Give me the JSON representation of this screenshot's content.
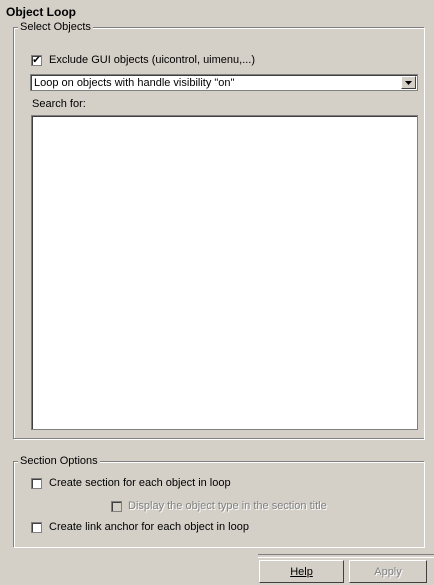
{
  "panel": {
    "title": "Object Loop"
  },
  "select_objects": {
    "legend": "Select Objects",
    "exclude_gui": {
      "label": "Exclude GUI objects (uicontrol, uimenu,...)",
      "checked": true
    },
    "loop_dropdown": {
      "selected": "Loop on objects with handle visibility \"on\""
    },
    "search_label": "Search for:"
  },
  "section_options": {
    "legend": "Section Options",
    "create_section": {
      "label": "Create section for each object in loop",
      "checked": false
    },
    "display_type": {
      "label": "Display the object type in the section title",
      "checked": false,
      "enabled": false
    },
    "create_anchor": {
      "label": "Create link anchor for each object in loop",
      "checked": false
    }
  },
  "buttons": {
    "help": "Help",
    "apply": "Apply"
  },
  "icons": {
    "check": "check-icon",
    "dropdown": "dropdown-arrow-icon"
  }
}
